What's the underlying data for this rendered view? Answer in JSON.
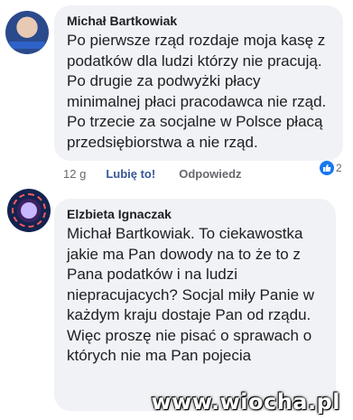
{
  "comments": [
    {
      "author": "Michał Bartkowiak",
      "text": "Po pierwsze rząd rozdaje moja kasę z podatków dla ludzi którzy nie pracują. Po drugie za podwyżki płacy minimalnej płaci pracodawca nie rząd. Po trzecie za socjalne w Polsce płacą przedsiębiorstwa a nie rząd.",
      "time": "12 g",
      "like_label": "Lubię to!",
      "reply_label": "Odpowiedz",
      "reaction_count": "2"
    },
    {
      "author": "Elzbieta Ignaczak",
      "text": "Michał Bartkowiak. To ciekawostka jakie ma Pan dowody na to że to z Pana podatków i na ludzi niepracujacych?  Socjal miły Panie w każdym kraju  dostaje Pan od rządu. Więc proszę nie pisać  o sprawach o których nie ma Pan pojecia"
    }
  ],
  "watermark": "www.wiocha.pl",
  "colors": {
    "bubble": "#f0f2f5",
    "link": "#385898",
    "like_icon": "#1877f2"
  }
}
